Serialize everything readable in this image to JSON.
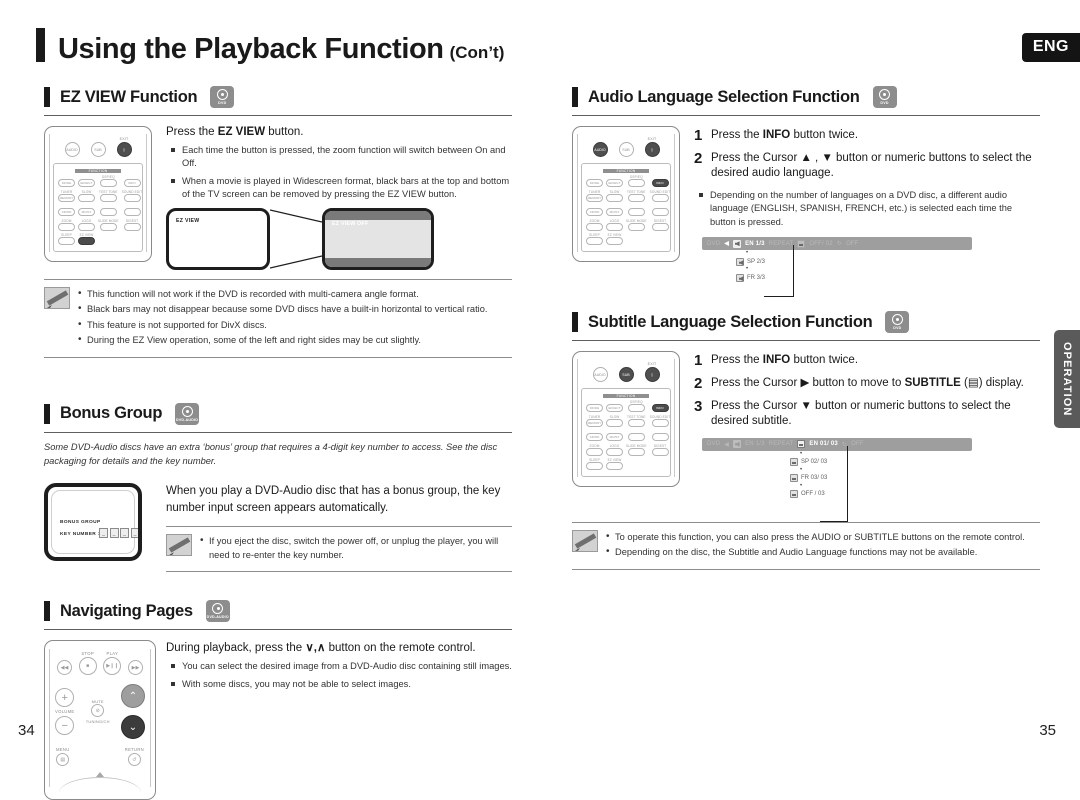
{
  "header": {
    "title": "Using the Playback Function",
    "title_suffix": "(Con’t)",
    "lang_tag": "ENG",
    "side_tab": "OPERATION",
    "page_left": "34",
    "page_right": "35"
  },
  "sections": {
    "ez_view": {
      "title": "EZ VIEW Function",
      "badge": "DVD",
      "lead_pre": "Press the ",
      "lead_bold": "EZ VIEW",
      "lead_post": " button.",
      "bullets": [
        "Each time the button is pressed, the zoom function will switch between On and Off.",
        "When a movie is played in Widescreen format, black bars at the top and bottom of the TV screen can be removed by pressing the EZ VIEW button."
      ],
      "tv_left_label": "EZ VIEW",
      "tv_right_label": "EZ VIEW OFF",
      "notes": [
        "This function will not work if the DVD is recorded with multi-camera angle format.",
        "Black bars may not disappear because some DVD discs have a built-in horizontal to vertical ratio.",
        "This feature is not supported for DivX discs.",
        "During the EZ View operation, some of the left and right sides may be cut slightly."
      ]
    },
    "bonus_group": {
      "title": "Bonus Group",
      "badge": "DVD-AUDIO",
      "intro": "Some DVD-Audio discs have an extra ‘bonus’ group that requires a 4-digit key number to access. See the disc packaging for details and the key number.",
      "body": "When you play a DVD-Audio disc that has a bonus group, the key number input screen appears automatically.",
      "tv_title": "BONUS GROUP",
      "tv_key_label": "KEY NUMBER :",
      "tv_key_digits": [
        "_",
        "_",
        "_",
        "_"
      ],
      "notes": [
        "If you eject the disc, switch the power off, or unplug the player, you will need to re-enter the key number."
      ]
    },
    "navigating_pages": {
      "title": "Navigating Pages",
      "badge": "DVD-AUDIO",
      "lead_pre": "During playback, press the ",
      "lead_keys": "∨,∧",
      "lead_post": " button on the remote control.",
      "bullets": [
        "You can select the desired image from a DVD-Audio disc containing still images.",
        "With some discs, you may not be able to select images."
      ]
    },
    "audio_language": {
      "title": "Audio Language Selection Function",
      "badge": "DVD",
      "steps": [
        {
          "num": "1",
          "pre": "Press the ",
          "bold": "INFO",
          "post": " button twice."
        },
        {
          "num": "2",
          "pre": "Press the Cursor ▲ , ▼ button or numeric buttons to select the desired audio language.",
          "bold": "",
          "post": ""
        }
      ],
      "bullets": [
        "Depending on the number of languages on a DVD disc, a different audio language (ENGLISH, SPANISH, FRENCH, etc.) is selected each time the button is pressed."
      ],
      "osd": {
        "disc": "DVD",
        "audio_current": "EN 1/3",
        "repeat_dim": "REPEAT",
        "subtitle_dim": "OFF/ 02",
        "angle_dim": "OFF",
        "options": [
          "SP 2/3",
          "FR 3/3"
        ]
      }
    },
    "subtitle_language": {
      "title": "Subtitle Language Selection Function",
      "badge": "DVD",
      "steps": [
        {
          "num": "1",
          "pre": "Press the ",
          "bold": "INFO",
          "post": " button twice."
        },
        {
          "num": "2",
          "pre": "Press the Cursor ▶ button to move to ",
          "bold": "SUBTITLE",
          "post": " (▤) display."
        },
        {
          "num": "3",
          "pre": "Press the Cursor ▼ button or numeric buttons to select the desired subtitle.",
          "bold": "",
          "post": ""
        }
      ],
      "osd": {
        "disc": "DVD",
        "audio_dim": "EN 1/3",
        "repeat_dim": "REPEAT",
        "subtitle_current": "EN 01/ 03",
        "angle_dim": "OFF",
        "options": [
          "SP 02/ 03",
          "FR 03/ 03",
          "OFF / 03"
        ]
      },
      "notes": [
        "To operate this function, you can also press the AUDIO or SUBTITLE buttons on the remote control.",
        "Depending on the disc, the Subtitle and Audio Language functions may not be available."
      ]
    }
  },
  "remote": {
    "top_row": [
      {
        "label": "",
        "key": "AUDIO",
        "dark": false
      },
      {
        "label": "",
        "key": "SUB TITLE",
        "dark": false
      },
      {
        "label": "EXIT",
        "key": "",
        "dark": true
      }
    ],
    "grid_title": "FUNCTION",
    "grid_col_label_2": "DSP/EQ",
    "rows": [
      [
        {
          "label": "",
          "key": "MODE"
        },
        {
          "label": "",
          "key": "EFFECT"
        },
        {
          "label": "",
          "key": ""
        },
        {
          "label": "",
          "key": "INFO"
        }
      ],
      [
        {
          "label": "TUNER MEMORY",
          "key": ""
        },
        {
          "label": "SLOW",
          "key": ""
        },
        {
          "label": "TEST TONE",
          "key": ""
        },
        {
          "label": "SOUND EDIT",
          "key": ""
        }
      ],
      [
        {
          "label": "",
          "key": "SD/HD"
        },
        {
          "label": "",
          "key": "MO/ST"
        },
        {
          "label": "",
          "key": ""
        },
        {
          "label": "",
          "key": ""
        }
      ],
      [
        {
          "label": "ZOOM",
          "key": ""
        },
        {
          "label": "LOGO",
          "key": ""
        },
        {
          "label": "SLIDE MODE",
          "key": ""
        },
        {
          "label": "DIGEST",
          "key": ""
        }
      ],
      [
        {
          "label": "SLEEP",
          "key": ""
        },
        {
          "label": "EZ VIEW",
          "key": ""
        }
      ]
    ],
    "nav": {
      "stop_label": "STOP",
      "play_label": "PLAY",
      "volume_label": "VOLUME",
      "mute_label": "MUTE",
      "tuning_label": "TUNING/CH",
      "menu_label": "MENU",
      "return_label": "RETURN",
      "plus": "+",
      "minus": "−",
      "up": "︿",
      "down": "﹀"
    }
  }
}
